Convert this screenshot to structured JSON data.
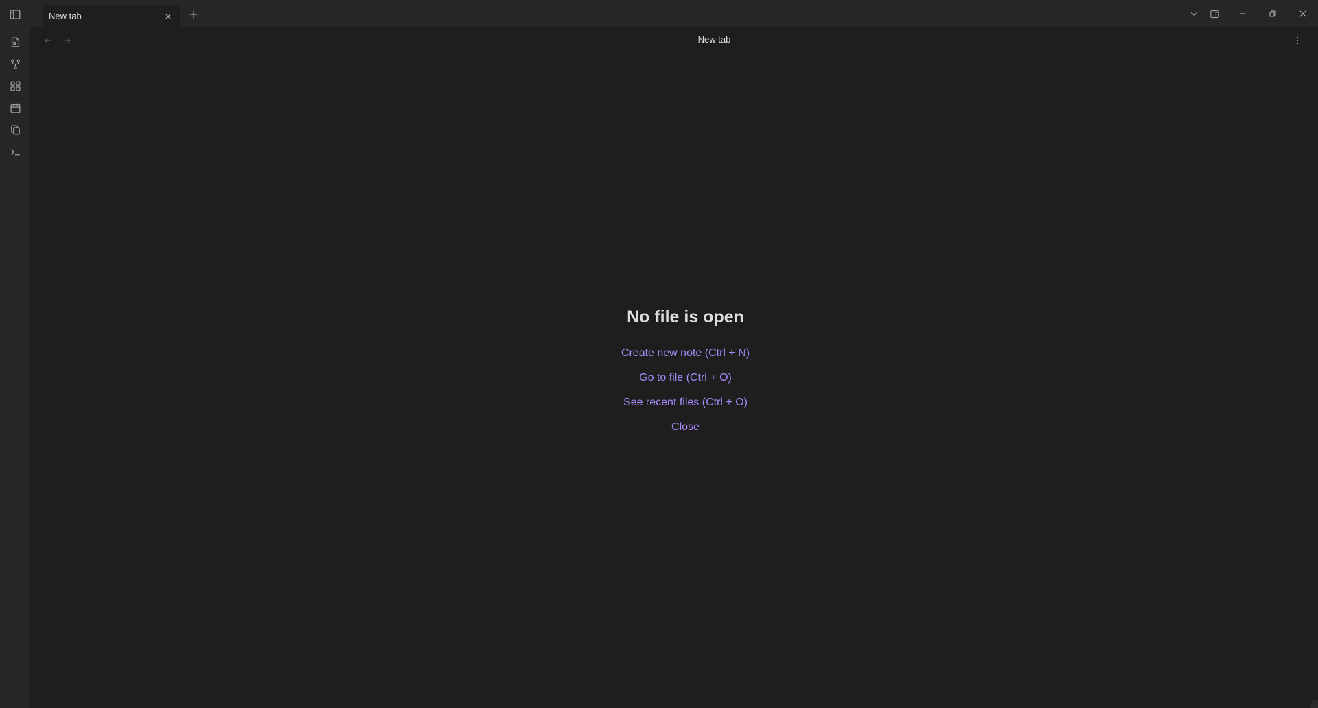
{
  "titlebar": {
    "tab_title": "New tab"
  },
  "view": {
    "title": "New tab"
  },
  "empty_state": {
    "title": "No file is open",
    "actions": [
      {
        "label": "Create new note (Ctrl + N)"
      },
      {
        "label": "Go to file (Ctrl + O)"
      },
      {
        "label": "See recent files (Ctrl + O)"
      },
      {
        "label": "Close"
      }
    ]
  },
  "ribbon": {
    "items": [
      {
        "icon": "open-quick-switcher-icon"
      },
      {
        "icon": "graph-view-icon"
      },
      {
        "icon": "canvas-icon"
      },
      {
        "icon": "daily-note-calendar-icon"
      },
      {
        "icon": "templates-icon"
      },
      {
        "icon": "command-palette-icon"
      }
    ]
  },
  "colors": {
    "background": "#1e1e1e",
    "titlebar": "#262626",
    "accent_link": "#a88bfa",
    "text": "#dcddde",
    "icon": "#a0a0a0"
  }
}
